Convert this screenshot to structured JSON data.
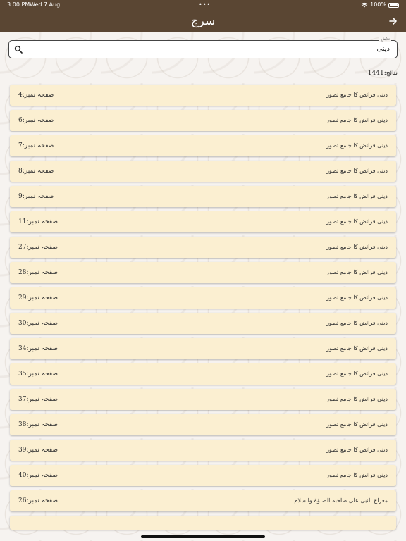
{
  "status_bar": {
    "time": "3:00 PM",
    "date": "Wed 7 Aug",
    "dots": "•••",
    "battery": "100%"
  },
  "nav": {
    "title": "سرچ"
  },
  "search": {
    "legend": "تلاش",
    "value": "دینی"
  },
  "result_count": "نتائج:1441",
  "results": [
    {
      "text": "دینی فرائض کا جامع تصور",
      "page": "صفحہ نمبر:4"
    },
    {
      "text": "دینی فرائض کا جامع تصور",
      "page": "صفحہ نمبر:6"
    },
    {
      "text": "دینی فرائض کا جامع تصور",
      "page": "صفحہ نمبر:7"
    },
    {
      "text": "دینی فرائض کا جامع تصور",
      "page": "صفحہ نمبر:8"
    },
    {
      "text": "دینی فرائض کا جامع تصور",
      "page": "صفحہ نمبر:9"
    },
    {
      "text": "دینی فرائض کا جامع تصور",
      "page": "صفحہ نمبر:11"
    },
    {
      "text": "دینی فرائض کا جامع تصور",
      "page": "صفحہ نمبر:27"
    },
    {
      "text": "دینی فرائض کا جامع تصور",
      "page": "صفحہ نمبر:28"
    },
    {
      "text": "دینی فرائض کا جامع تصور",
      "page": "صفحہ نمبر:29"
    },
    {
      "text": "دینی فرائض کا جامع تصور",
      "page": "صفحہ نمبر:30"
    },
    {
      "text": "دینی فرائض کا جامع تصور",
      "page": "صفحہ نمبر:34"
    },
    {
      "text": "دینی فرائض کا جامع تصور",
      "page": "صفحہ نمبر:35"
    },
    {
      "text": "دینی فرائض کا جامع تصور",
      "page": "صفحہ نمبر:37"
    },
    {
      "text": "دینی فرائض کا جامع تصور",
      "page": "صفحہ نمبر:38"
    },
    {
      "text": "دینی فرائض کا جامع تصور",
      "page": "صفحہ نمبر:39"
    },
    {
      "text": "دینی فرائض کا جامع تصور",
      "page": "صفحہ نمبر:40"
    },
    {
      "text": "معراج النبی علی صاحبہ الصلوٰۃ والسلام",
      "page": "صفحہ نمبر:26"
    },
    {
      "text": "",
      "page": ""
    }
  ]
}
